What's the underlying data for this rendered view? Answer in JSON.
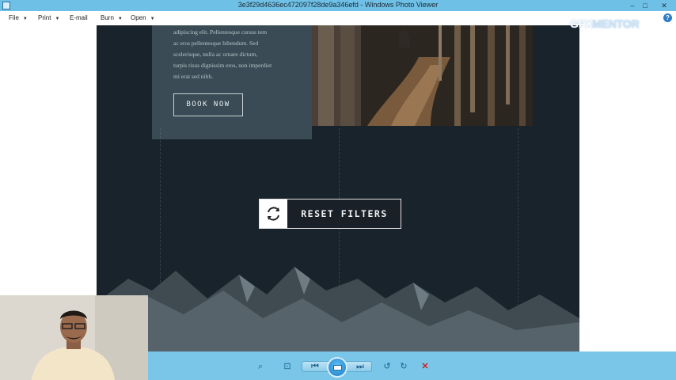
{
  "window": {
    "title": "3e3f29d4636ec472097f28de9a346efd - Windows Photo Viewer",
    "controls": {
      "minimize": "–",
      "maximize": "□",
      "close": "✕"
    }
  },
  "menu": {
    "items": [
      {
        "label": "File",
        "has_dropdown": true
      },
      {
        "label": "Print",
        "has_dropdown": true
      },
      {
        "label": "E-mail",
        "has_dropdown": false
      },
      {
        "label": "Burn",
        "has_dropdown": true
      },
      {
        "label": "Open",
        "has_dropdown": true
      }
    ],
    "help": "?"
  },
  "watermark": {
    "text_main": "GFX",
    "text_accent": "MENTOR"
  },
  "photo": {
    "card_text": [
      "adipiscing elit. Pellentesque cursus tem",
      "ac eros pellentesque bibendum. Sed",
      "scelerisque, nulla ac ornare dictum,",
      "turpis risus dignissim eros, non imperdiet",
      "mi erat sed nibh."
    ],
    "book_now": "BOOK NOW",
    "reset_filters": "RESET FILTERS"
  },
  "toolbar": {
    "zoom": "⌕",
    "fit": "⊡",
    "previous": "⏮",
    "next": "⏭",
    "rotate_left": "↺",
    "rotate_right": "↻",
    "delete": "✕"
  },
  "colors": {
    "titlebar": "#6fc0e6",
    "toolbar": "#79c6e8",
    "photo_bg": "#18232b",
    "card_bg": "#3a4b55",
    "delete_red": "#d12020"
  }
}
